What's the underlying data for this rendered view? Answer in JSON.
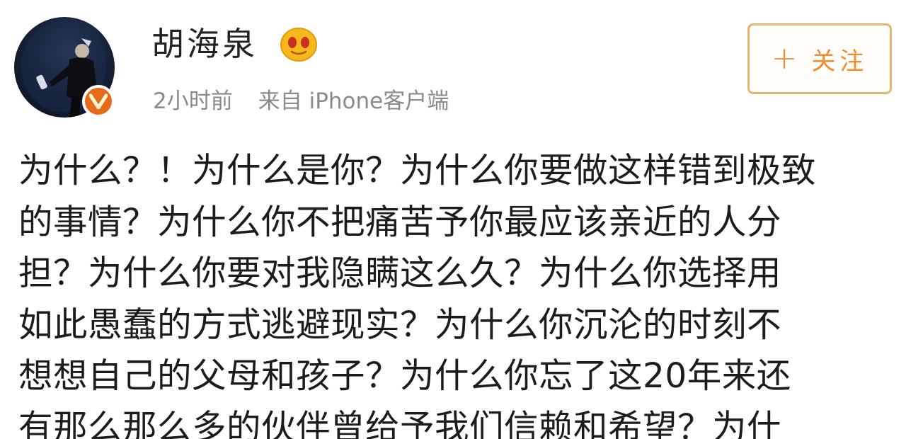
{
  "post": {
    "user": {
      "name": "胡海泉",
      "avatar_icon": "user-avatar",
      "verified_icon": "verified-v-badge",
      "member_icon": "vip-member-face-icon"
    },
    "meta": {
      "time": "2小时前",
      "source": "来自 iPhone客户端"
    },
    "follow_button": {
      "plus": "+",
      "label": "关注"
    },
    "text_lines": [
      "为什么？！为什么是你？为什么你要做这样错到极致",
      "的事情？为什么你不把痛苦予你最应该亲近的人分",
      "担？为什么你要对我隐瞒这么久？为什么你选择用",
      "如此愚蠢的方式逃避现实？为什么你沉沦的时刻不",
      "想想自己的父母和孩子？为什么你忘了这20年来还",
      "有那么那么多的伙伴曾给予我们信赖和希望？为什"
    ]
  },
  "colors": {
    "accent_orange": "#f08a2e",
    "follow_border": "#e8b570",
    "meta_gray": "#8a8a8a",
    "verified_orange": "#e76a1a",
    "member_yellow": "#f6b81c"
  }
}
